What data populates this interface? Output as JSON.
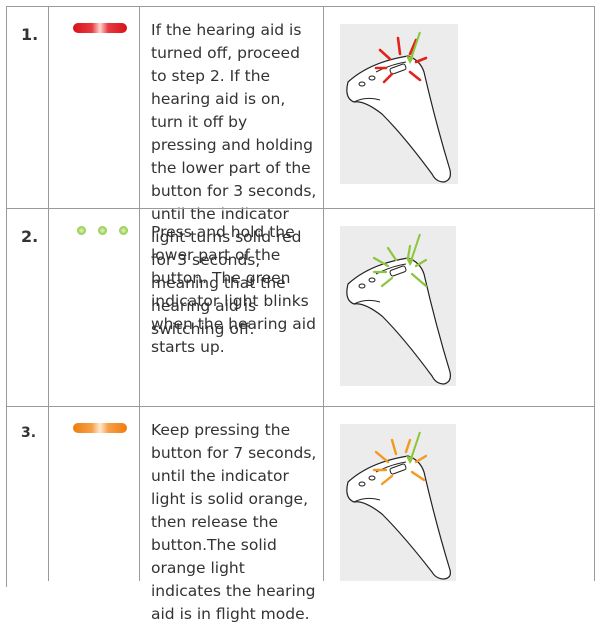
{
  "steps": [
    {
      "number": "1.",
      "indicator": "solid-red-bar",
      "text": "If the hearing aid is turned off, proceed to step 2. If the hearing aid is on, turn it off by pressing and holding the lower part of the button for 3 seconds, until the indicator light turns solid red for 3 seconds, meaning that the hearing aid is switching off.",
      "illustration": "hearing-aid-red-light"
    },
    {
      "number": "2.",
      "indicator": "blinking-green-dots",
      "text": "Press and hold the lower part of the button. The green indicator light blinks when the hearing aid starts up.",
      "illustration": "hearing-aid-green-light"
    },
    {
      "number": "3.",
      "indicator": "solid-orange-bar",
      "text": "Keep pressing the button  for 7 seconds, until the indicator light is solid orange, then release the button.The solid orange light indicates the hearing aid is in flight mode.",
      "illustration": "hearing-aid-orange-light"
    }
  ],
  "colors": {
    "red": "#e2231a",
    "green": "#8cc63f",
    "orange": "#f39a1e",
    "arrow": "#8cc63f",
    "border": "#9a9a9a",
    "image_bg": "#ececec"
  }
}
